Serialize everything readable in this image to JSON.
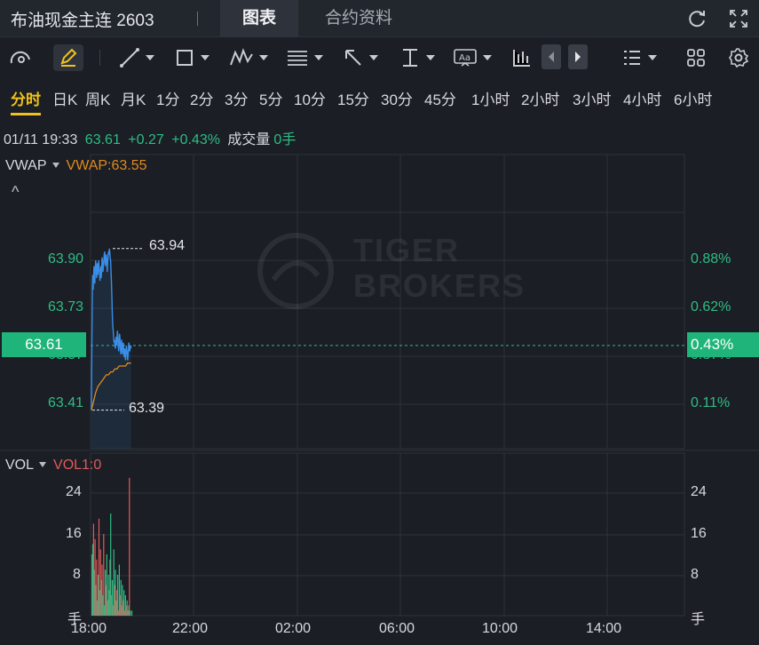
{
  "header": {
    "title": "布油现金主连 2603",
    "tabs": [
      {
        "label": "图表",
        "active": true
      },
      {
        "label": "合约资料",
        "active": false
      }
    ],
    "icons": [
      "refresh-icon",
      "fullscreen-icon"
    ]
  },
  "toolbar": {
    "icons": [
      "cursor-curve-icon",
      "pencil-icon",
      "line-icon",
      "rectangle-icon",
      "pattern-icon",
      "fibonacci-icon",
      "arrow-icon",
      "measure-icon",
      "text-icon",
      "candle-icon",
      "prev-icon",
      "next-icon",
      "list-icon",
      "grid-icon",
      "gear-icon"
    ]
  },
  "periods": [
    "分时",
    "日K",
    "周K",
    "月K",
    "1分",
    "2分",
    "3分",
    "5分",
    "10分",
    "15分",
    "30分",
    "45分",
    "1小时",
    "2小时",
    "3小时",
    "4小时",
    "6小时"
  ],
  "active_period": "分时",
  "quote": {
    "datetime": "01/11 19:33",
    "price": "63.61",
    "change": "+0.27",
    "change_pct": "+0.43%",
    "volume_label": "成交量",
    "volume": "0手"
  },
  "price_panel": {
    "indicator": "VWAP",
    "indicator_value": "VWAP:63.55",
    "collapse_glyph": "^",
    "left_ticks": [
      "63.90",
      "63.73",
      "63.57",
      "63.41"
    ],
    "right_ticks": [
      "0.88%",
      "0.62%",
      "0.37%",
      "0.11%"
    ],
    "current_price": "63.61",
    "current_pct": "0.43%",
    "high_label": "63.94",
    "low_label": "63.39",
    "colors": {
      "price_line": "#3a8ee6",
      "vwap_line": "#e08a1e",
      "up": "#2ebd85",
      "down": "#e05a5a"
    }
  },
  "volume_panel": {
    "indicator": "VOL",
    "indicator_value": "VOL1:0",
    "ticks": [
      "24",
      "16",
      "8"
    ],
    "unit": "手"
  },
  "time_axis": [
    "18:00",
    "22:00",
    "02:00",
    "06:00",
    "10:00",
    "14:00"
  ],
  "watermark": {
    "line1": "TIGER",
    "line2": "BROKERS"
  },
  "chart_data": {
    "type": "line",
    "title": "",
    "xlabel": "",
    "ylabel": "",
    "x_ticks": [
      "18:00",
      "22:00",
      "02:00",
      "06:00",
      "10:00",
      "14:00"
    ],
    "ylim": [
      63.36,
      63.98
    ],
    "series": [
      {
        "name": "",
        "x_minutes": [
          0,
          1,
          2,
          3,
          4,
          5,
          6,
          7,
          8,
          9,
          10,
          11,
          12,
          13,
          14,
          15,
          16,
          17,
          18,
          19,
          20,
          21,
          22,
          23,
          24,
          25,
          26,
          27,
          28,
          29,
          30,
          31,
          32,
          33,
          34,
          35,
          36,
          37,
          38,
          39,
          40,
          41,
          42,
          43,
          44,
          45,
          46,
          47,
          48,
          49,
          50,
          51,
          52,
          53,
          54,
          55,
          56,
          57,
          58,
          59,
          60,
          61,
          62,
          63,
          64,
          65,
          66,
          67,
          68,
          69,
          70,
          71,
          72,
          73,
          74,
          75,
          76,
          77,
          78,
          79,
          80,
          81,
          82,
          83,
          84,
          85,
          86,
          87,
          88,
          89,
          90,
          91,
          92,
          93
        ],
        "values": [
          63.39,
          63.62,
          63.8,
          63.85,
          63.8,
          63.84,
          63.88,
          63.86,
          63.82,
          63.87,
          63.9,
          63.88,
          63.84,
          63.86,
          63.89,
          63.85,
          63.87,
          63.9,
          63.88,
          63.86,
          63.83,
          63.85,
          63.88,
          63.84,
          63.87,
          63.91,
          63.9,
          63.86,
          63.88,
          63.89,
          63.92,
          63.93,
          63.9,
          63.88,
          63.91,
          63.92,
          63.9,
          63.86,
          63.89,
          63.91,
          63.93,
          63.92,
          63.94,
          63.93,
          63.91,
          63.9,
          63.86,
          63.82,
          63.78,
          63.72,
          63.68,
          63.66,
          63.64,
          63.62,
          63.63,
          63.61,
          63.6,
          63.62,
          63.64,
          63.61,
          63.63,
          63.66,
          63.64,
          63.61,
          63.59,
          63.62,
          63.65,
          63.63,
          63.6,
          63.58,
          63.61,
          63.63,
          63.6,
          63.58,
          63.6,
          63.62,
          63.59,
          63.57,
          63.6,
          63.58,
          63.56,
          63.59,
          63.61,
          63.6,
          63.58,
          63.56,
          63.58,
          63.6,
          63.62,
          63.6,
          63.59,
          63.61,
          63.6,
          63.61
        ]
      },
      {
        "name": "VWAP",
        "x_minutes": [
          0,
          5,
          10,
          15,
          20,
          25,
          30,
          35,
          40,
          45,
          50,
          55,
          60,
          65,
          70,
          75,
          80,
          85,
          90,
          93
        ],
        "values": [
          63.39,
          63.42,
          63.45,
          63.47,
          63.48,
          63.49,
          63.5,
          63.51,
          63.51,
          63.52,
          63.52,
          63.53,
          63.53,
          63.54,
          63.54,
          63.54,
          63.54,
          63.55,
          63.55,
          63.55
        ]
      }
    ],
    "volume": {
      "ylim": [
        0,
        30
      ],
      "values": [
        12,
        14,
        18,
        9,
        15,
        6,
        11,
        3,
        8,
        19,
        5,
        13,
        7,
        10,
        4,
        16,
        2,
        9,
        6,
        12,
        3,
        8,
        5,
        11,
        20,
        4,
        7,
        2,
        13,
        6,
        9,
        3,
        5,
        8,
        1,
        10,
        4,
        7,
        2,
        6,
        3,
        5,
        1,
        4,
        2,
        3,
        1,
        2,
        27,
        1,
        0,
        1
      ],
      "colors": [
        "up",
        "up",
        "down",
        "up",
        "down",
        "up",
        "down",
        "up",
        "up",
        "down",
        "up",
        "down",
        "up",
        "down",
        "up",
        "down",
        "up",
        "up",
        "down",
        "up",
        "down",
        "up",
        "up",
        "down",
        "up",
        "down",
        "up",
        "down",
        "up",
        "down",
        "up",
        "up",
        "down",
        "up",
        "down",
        "up",
        "down",
        "up",
        "down",
        "up",
        "down",
        "up",
        "down",
        "up",
        "down",
        "up",
        "down",
        "up",
        "down",
        "up",
        "down",
        "up"
      ]
    }
  }
}
